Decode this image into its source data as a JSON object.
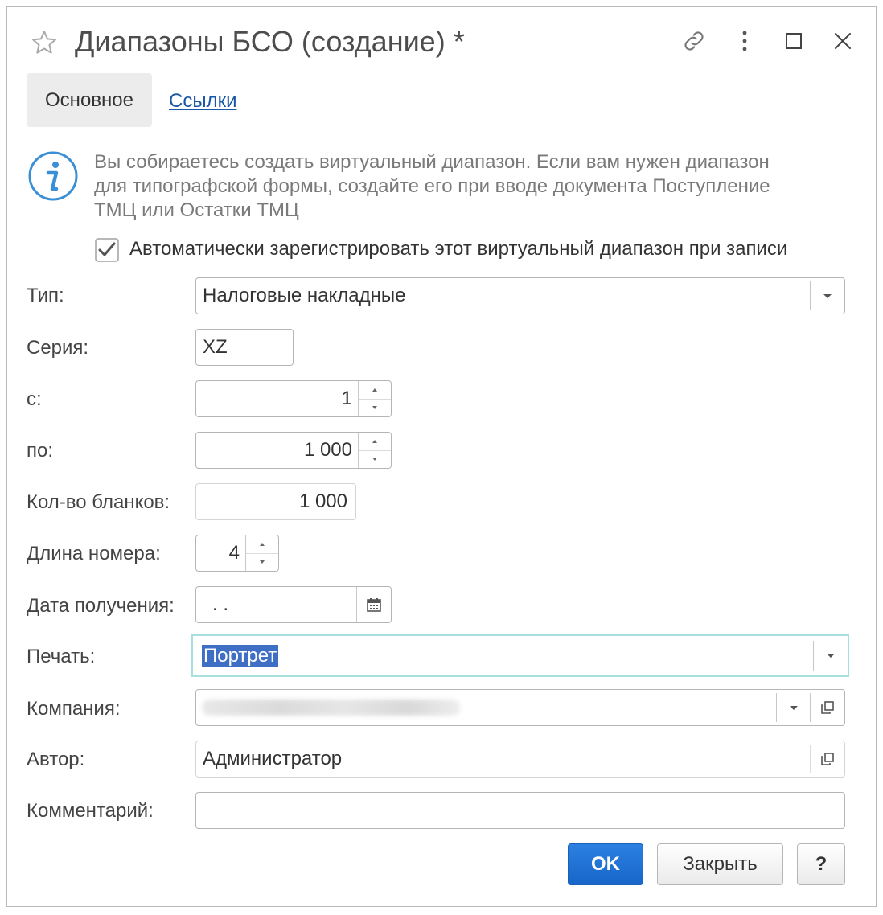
{
  "window": {
    "title": "Диапазоны БСО (создание) *"
  },
  "tabs": [
    {
      "label": "Основное",
      "active": true
    },
    {
      "label": "Ссылки",
      "active": false
    }
  ],
  "info": {
    "text": "Вы собираетесь создать виртуальный диапазон. Если вам нужен диапазон для типографской формы, создайте его при вводе документа Поступление ТМЦ или Остатки ТМЦ"
  },
  "auto_register": {
    "label": "Автоматически зарегистрировать этот виртуальный диапазон при записи",
    "checked": true
  },
  "form": {
    "type": {
      "label": "Тип:",
      "value": "Налоговые накладные"
    },
    "series": {
      "label": "Серия:",
      "value": "XZ"
    },
    "from": {
      "label": "с:",
      "value": "1"
    },
    "to": {
      "label": "по:",
      "value": "1 000"
    },
    "count": {
      "label": "Кол-во бланков:",
      "value": "1 000"
    },
    "length": {
      "label": "Длина номера:",
      "value": "4"
    },
    "date": {
      "label": "Дата получения:",
      "value": " .  ."
    },
    "print": {
      "label": "Печать:",
      "value": "Портрет"
    },
    "company": {
      "label": "Компания:",
      "value": ""
    },
    "author": {
      "label": "Автор:",
      "value": "Администратор"
    },
    "comment": {
      "label": "Комментарий:",
      "value": ""
    }
  },
  "buttons": {
    "ok": "OK",
    "close": "Закрыть",
    "help": "?"
  },
  "colors": {
    "accent": "#1766c9",
    "link": "#1a57a6",
    "focus_border": "#a6e0de",
    "selection": "#3f6ec5",
    "info_icon": "#3a8fd6"
  }
}
